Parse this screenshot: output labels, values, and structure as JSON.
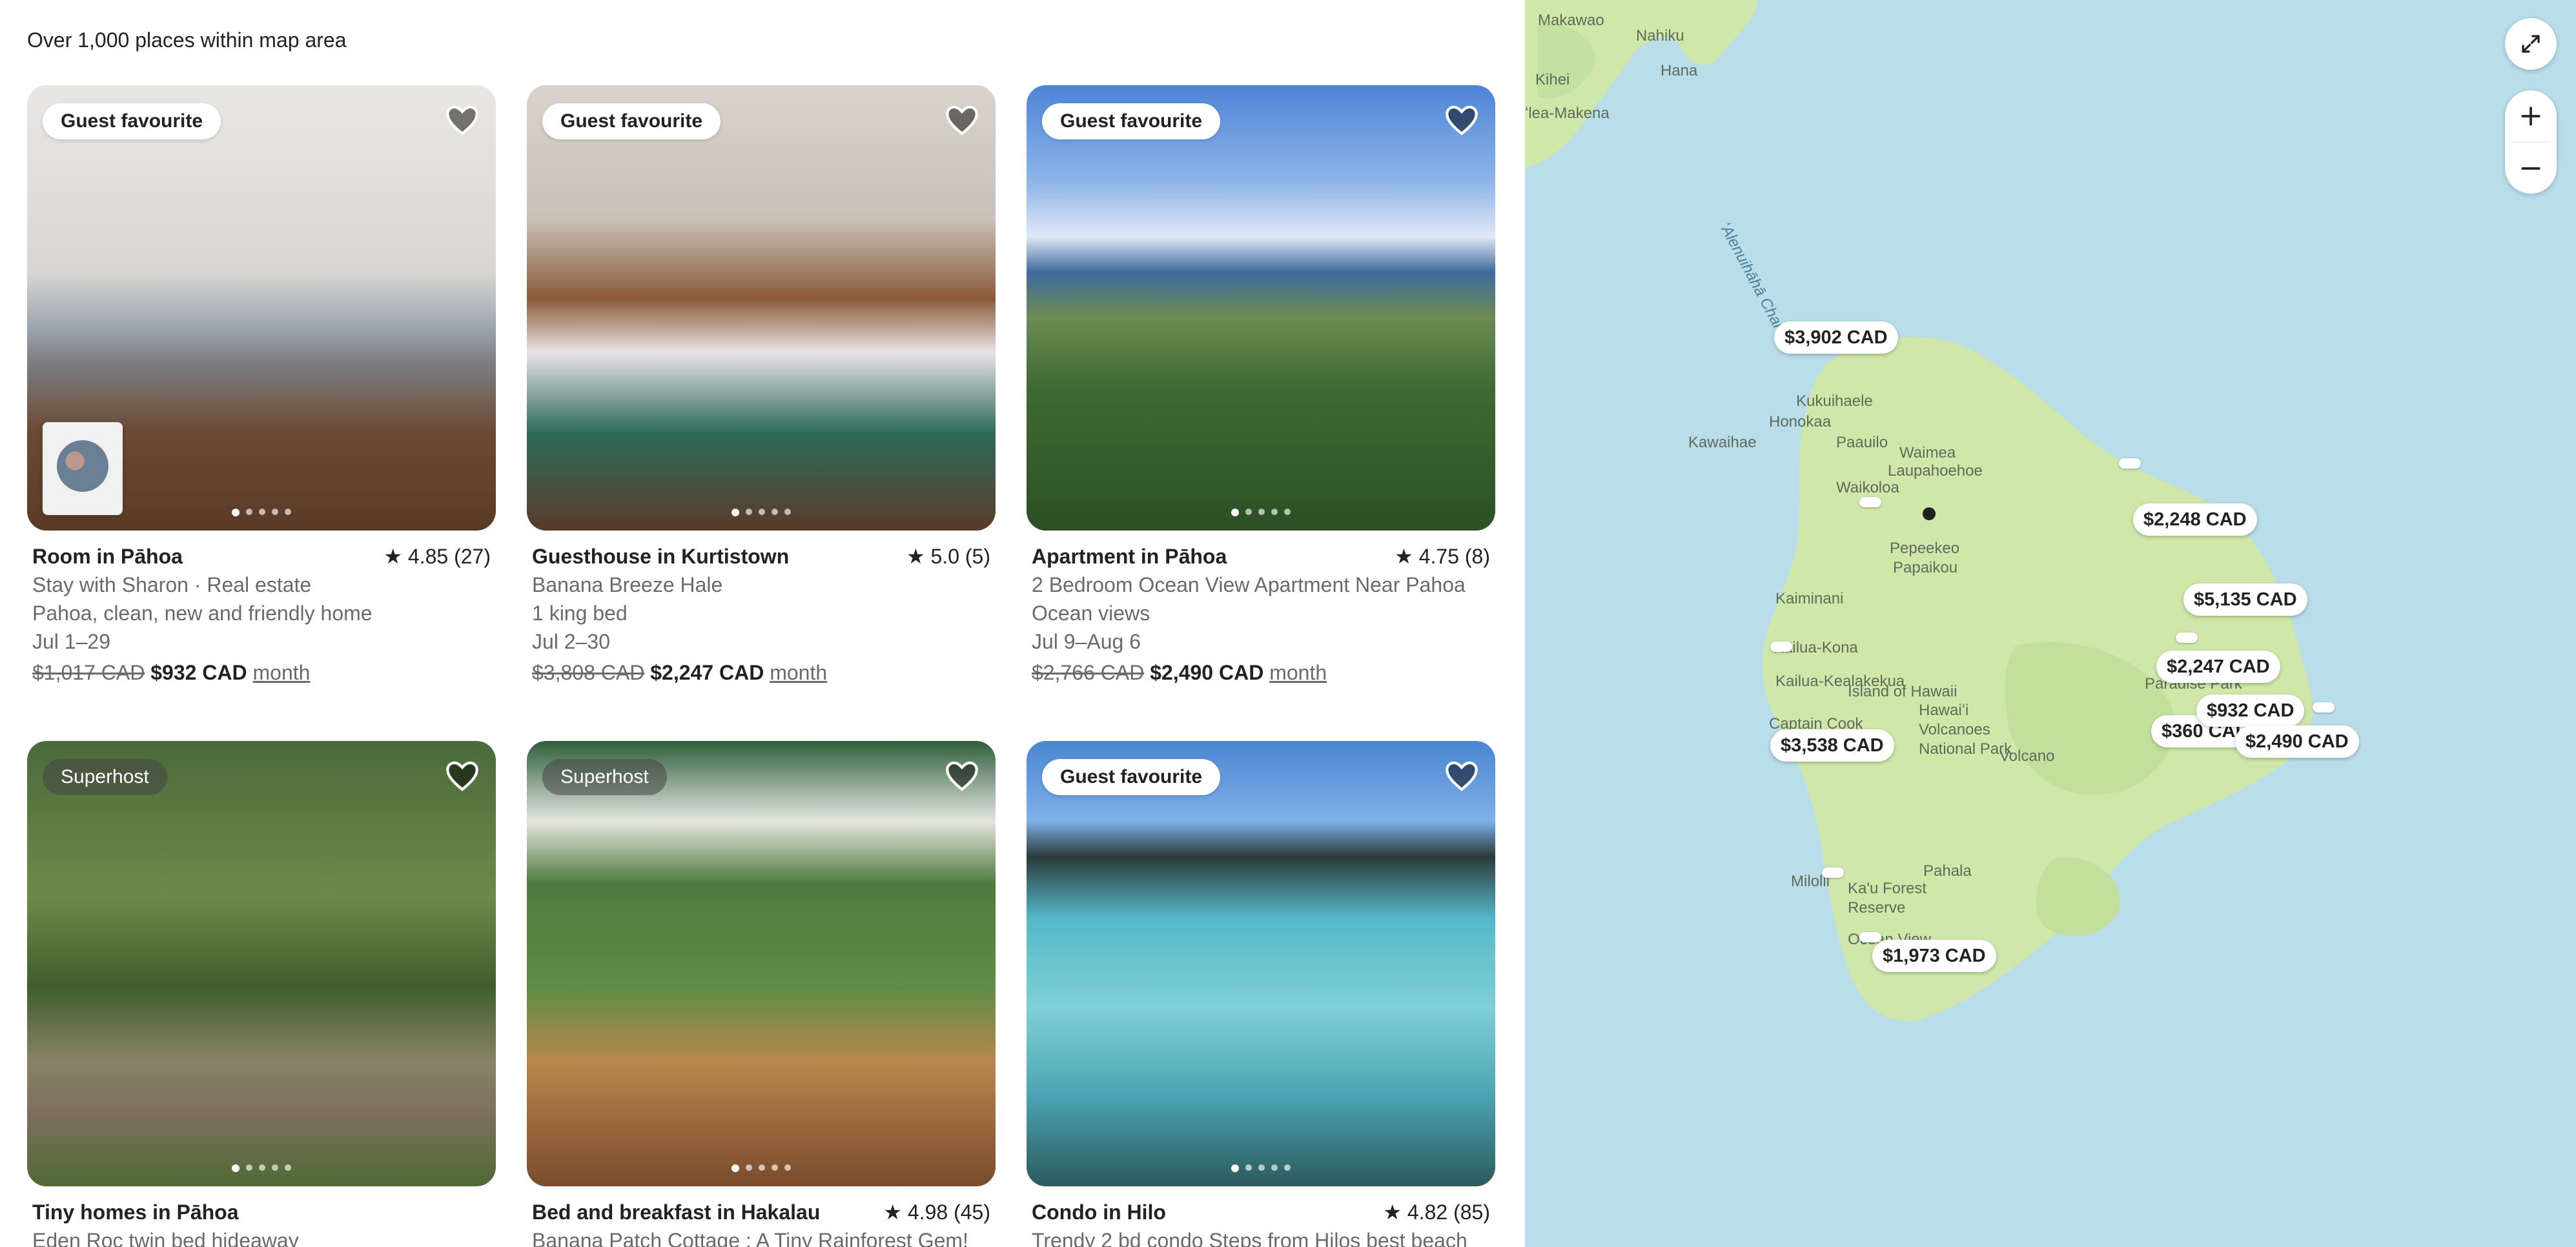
{
  "header": {
    "count_text": "Over 1,000 places within map area"
  },
  "listings": [
    {
      "badge": "Guest favourite",
      "type": "Room in Pāhoa",
      "rating": "★ 4.85 (27)",
      "lines": [
        "Stay with Sharon · Real estate",
        "Pahoa, clean, new and friendly home",
        "Jul 1–29"
      ],
      "price_old": "$1,017 CAD",
      "price_now": "$932 CAD",
      "price_per": "month"
    },
    {
      "badge": "Guest favourite",
      "type": "Guesthouse in Kurtistown",
      "rating": "★ 5.0 (5)",
      "lines": [
        "Banana Breeze Hale",
        "1 king bed",
        "Jul 2–30"
      ],
      "price_old": "$3,808 CAD",
      "price_now": "$2,247 CAD",
      "price_per": "month"
    },
    {
      "badge": "Guest favourite",
      "type": "Apartment in Pāhoa",
      "rating": "★ 4.75 (8)",
      "lines": [
        "2 Bedroom Ocean View Apartment Near Pahoa",
        "Ocean views",
        "Jul 9–Aug 6"
      ],
      "price_old": "$2,766 CAD",
      "price_now": "$2,490 CAD",
      "price_per": "month"
    },
    {
      "badge": "Superhost",
      "type": "Tiny homes in Pāhoa",
      "rating": "",
      "lines": [
        "Eden Roc twin bed hideaway"
      ]
    },
    {
      "badge": "Superhost",
      "type": "Bed and breakfast in Hakalau",
      "rating": "★ 4.98 (45)",
      "lines": [
        "Banana Patch Cottage ; A Tiny Rainforest Gem!"
      ]
    },
    {
      "badge": "Guest favourite",
      "type": "Condo in Hilo",
      "rating": "★ 4.82 (85)",
      "lines": [
        "Trendy 2 bd condo Steps from Hilos best beach"
      ]
    }
  ],
  "map": {
    "places": [
      "Makawao",
      "Nahiku",
      "Hana",
      "Kihei",
      "ʻlea-Makena",
      "ʻAlenuihāhā Channel",
      "Kukuihaele",
      "Honokaa",
      "Paauilo",
      "Kawaihae",
      "Waimea",
      "Laupahoehoe",
      "Waikoloa",
      "Pepeekeo",
      "Papaikou",
      "Kaiminani",
      "Kailua-Kona",
      "Kailua-Kealakekua",
      "Island of Hawaii",
      "Hawaiʻi Volcanoes National Park",
      "Captain Cook",
      "Volcano",
      "Pahala",
      "Ka'u Forest Reserve",
      "Milolii",
      "Ocean View",
      "Paradise Park"
    ],
    "price_pins": [
      "$3,902 CAD",
      "$2,248 CAD",
      "$5,135 CAD",
      "$2,247 CAD",
      "$932 CAD",
      "$360 CAD",
      "$2,490 CAD",
      "$3,538 CAD",
      "$1,973 CAD"
    ]
  },
  "icons": {
    "heart": "heart-outline-icon",
    "expand": "expand-icon",
    "zoom_in": "plus-icon",
    "zoom_out": "minus-icon"
  },
  "colors": {
    "text": "#222222",
    "muted": "#6a6a6a",
    "sea": "#b9dde9",
    "land": "#cfe7a9"
  }
}
